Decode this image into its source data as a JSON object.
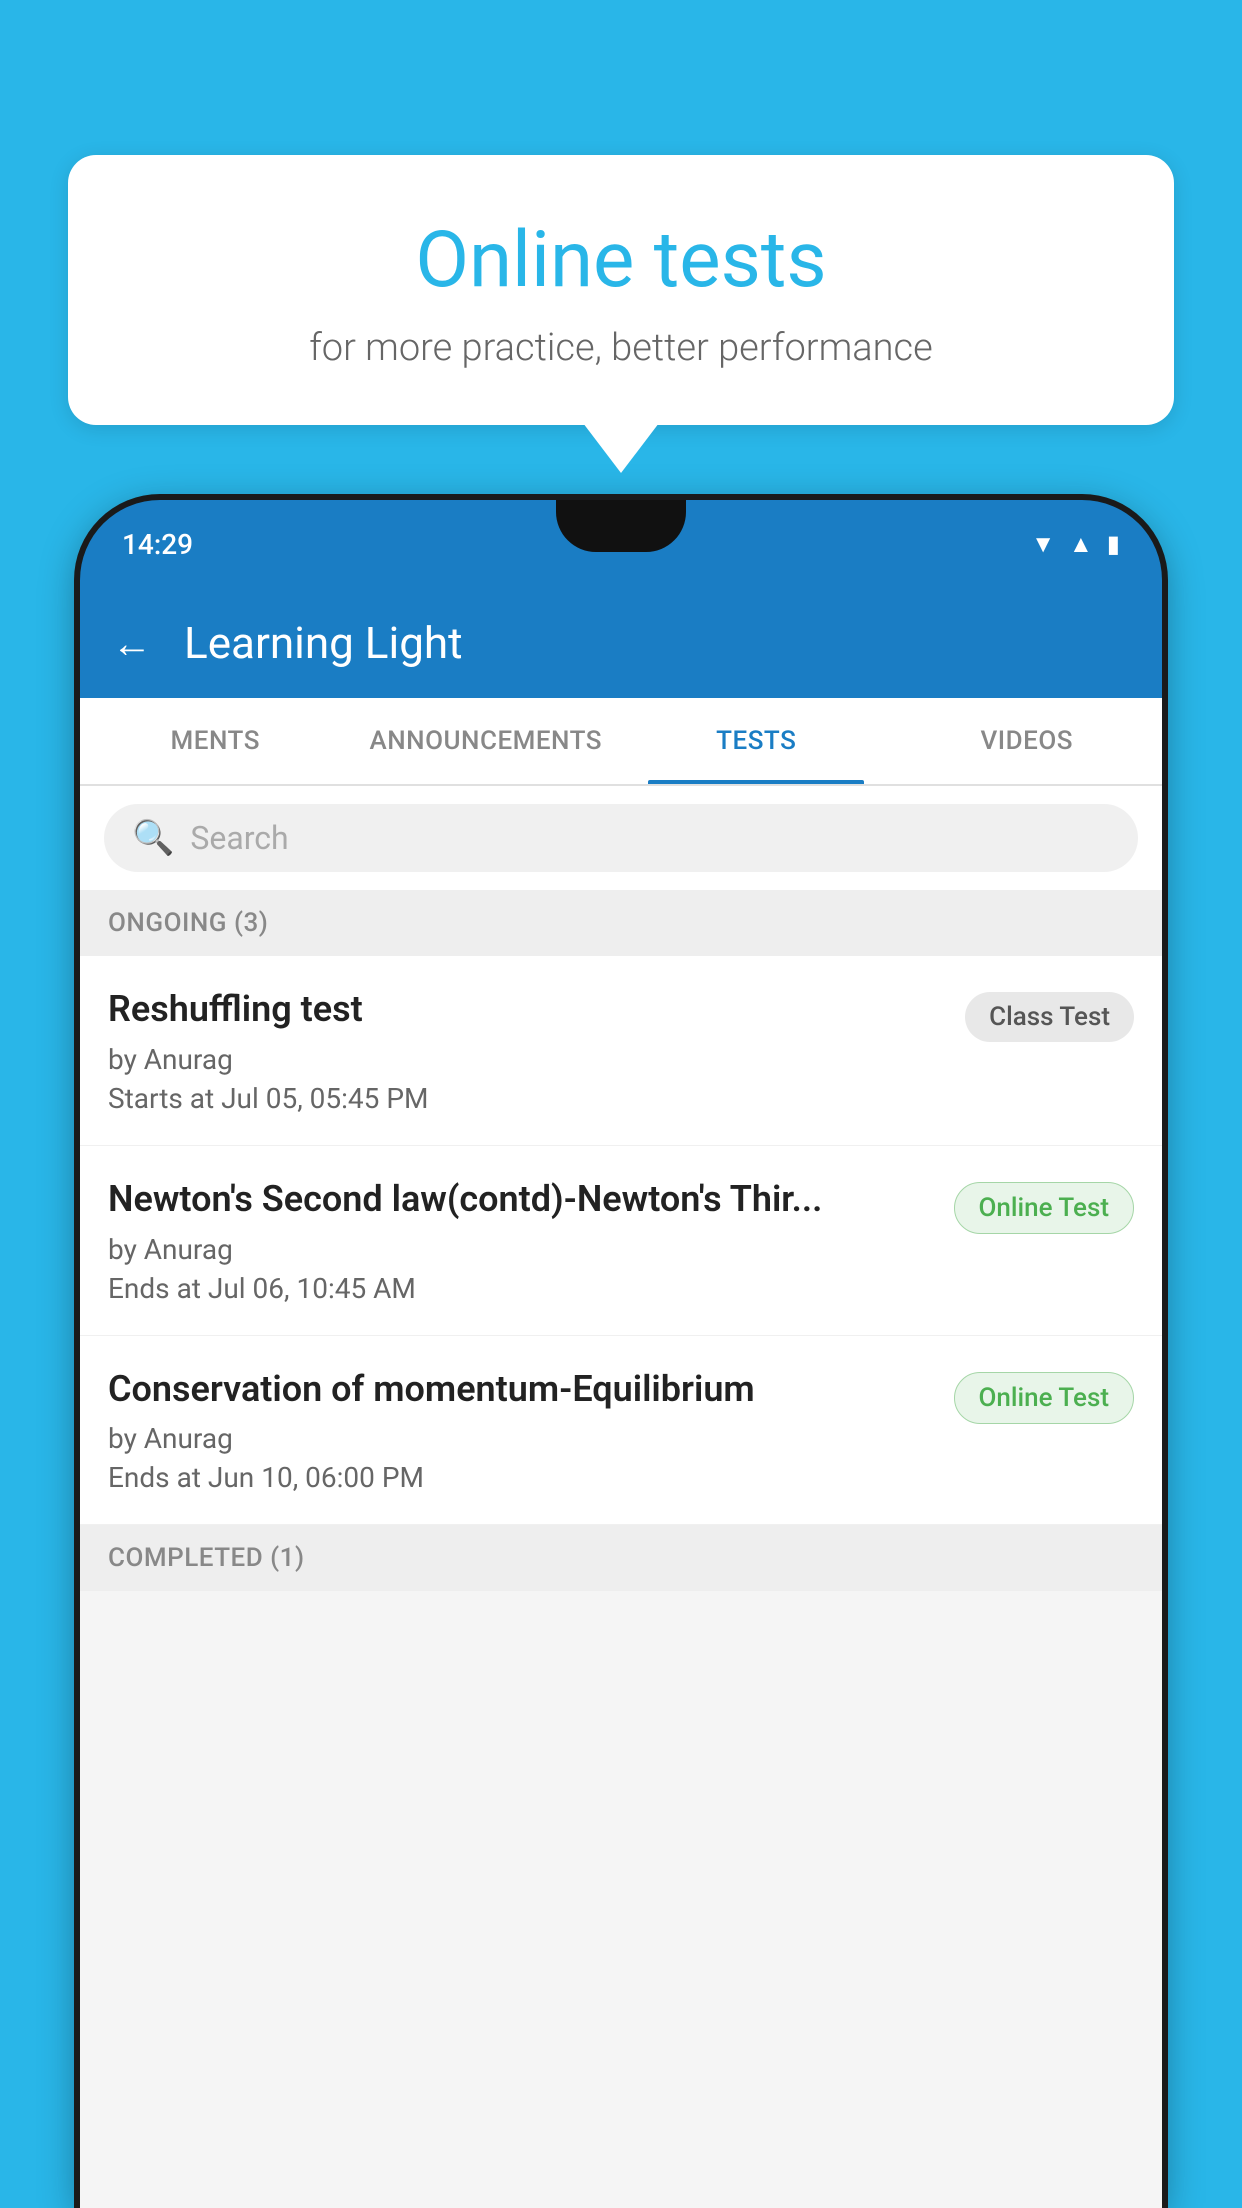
{
  "background_color": "#29b6e8",
  "bubble": {
    "title": "Online tests",
    "subtitle": "for more practice, better performance"
  },
  "phone": {
    "status_bar": {
      "time": "14:29",
      "icons": [
        "wifi",
        "signal",
        "battery"
      ]
    },
    "app_bar": {
      "title": "Learning Light",
      "back_label": "←"
    },
    "tabs": [
      {
        "label": "MENTS",
        "active": false
      },
      {
        "label": "ANNOUNCEMENTS",
        "active": false
      },
      {
        "label": "TESTS",
        "active": true
      },
      {
        "label": "VIDEOS",
        "active": false
      }
    ],
    "search": {
      "placeholder": "Search"
    },
    "ongoing_section": {
      "header": "ONGOING (3)",
      "items": [
        {
          "name": "Reshuffling test",
          "author": "by Anurag",
          "time_label": "Starts at",
          "time": "Jul 05, 05:45 PM",
          "badge": "Class Test",
          "badge_type": "class"
        },
        {
          "name": "Newton's Second law(contd)-Newton's Thir...",
          "author": "by Anurag",
          "time_label": "Ends at",
          "time": "Jul 06, 10:45 AM",
          "badge": "Online Test",
          "badge_type": "online"
        },
        {
          "name": "Conservation of momentum-Equilibrium",
          "author": "by Anurag",
          "time_label": "Ends at",
          "time": "Jun 10, 06:00 PM",
          "badge": "Online Test",
          "badge_type": "online"
        }
      ]
    },
    "completed_section": {
      "header": "COMPLETED (1)"
    }
  }
}
